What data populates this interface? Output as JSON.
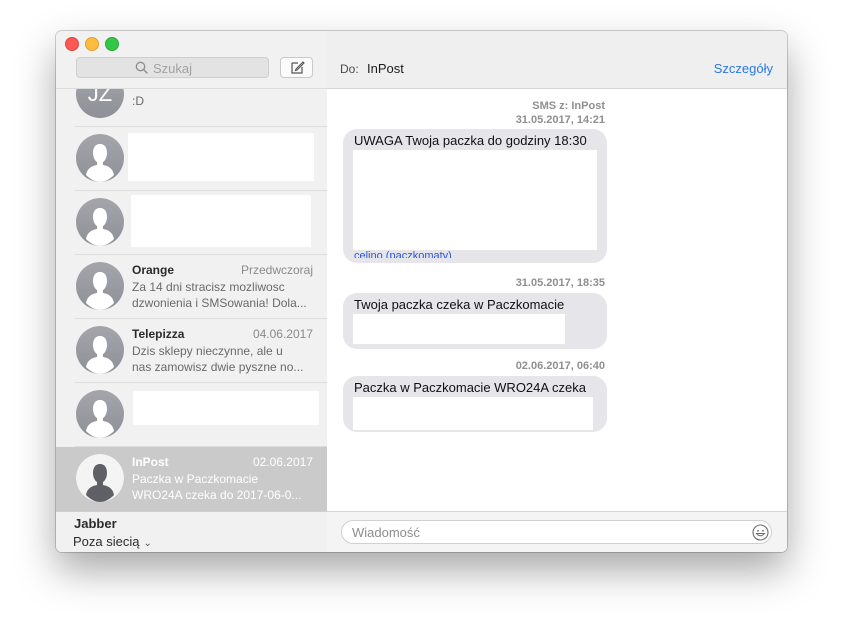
{
  "search": {
    "placeholder": "Szukaj"
  },
  "conversations": [
    {
      "initials": "JZ",
      "preview": ":D"
    },
    {
      "name": "",
      "date": "",
      "preview": ""
    },
    {
      "name": "",
      "date": "",
      "preview": ""
    },
    {
      "name": "Orange",
      "date": "Przedwczoraj",
      "preview_line1": "Za 14 dni stracisz mozliwosc",
      "preview_line2": "dzwonienia i SMSowania! Dola..."
    },
    {
      "name": "Telepizza",
      "date": "04.06.2017",
      "preview_line1": "Dzis sklepy nieczynne, ale u",
      "preview_line2": "nas zamowisz dwie pyszne no..."
    },
    {
      "name": "",
      "date": "",
      "preview": ""
    },
    {
      "name": "InPost",
      "date": "02.06.2017",
      "preview_line1": "Paczka w Paczkomacie",
      "preview_line2": "WRO24A czeka do 2017-06-0...",
      "selected": true
    }
  ],
  "account": {
    "name": "Jabber",
    "status": "Poza siecią"
  },
  "header": {
    "to_label": "Do:",
    "to_name": "InPost",
    "details": "Szczegóły"
  },
  "messages": [
    {
      "meta_line1": "SMS z: InPost",
      "meta_line2": "31.05.2017, 14:21",
      "text": "UWAGA Twoja paczka do godziny 18:30",
      "link_fragment": "celino (paczkomaty)"
    },
    {
      "meta_line1": "31.05.2017, 18:35",
      "text": "Twoja paczka czeka w Paczkomacie"
    },
    {
      "meta_line1": "02.06.2017, 06:40",
      "text": "Paczka w Paczkomacie WRO24A czeka"
    }
  ],
  "composer": {
    "placeholder": "Wiadomość"
  },
  "icons": {
    "search": "search-icon",
    "compose": "compose-icon",
    "emoji": "emoji-icon",
    "avatar": "person-silhouette-icon",
    "chevron": "chevron-down-icon"
  },
  "colors": {
    "accent": "#2a7ae2",
    "bubble": "#e5e5ea",
    "selected_row": "#cacaca"
  }
}
